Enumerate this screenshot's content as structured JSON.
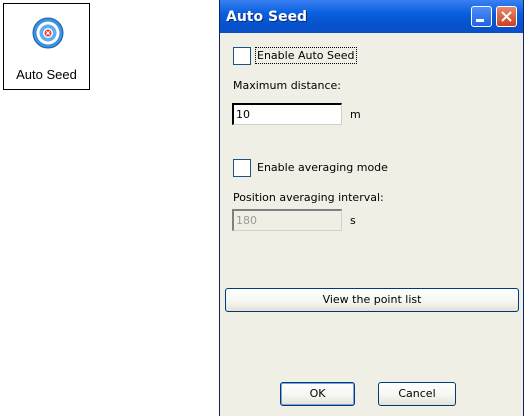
{
  "desktop_icon": {
    "label": "Auto Seed",
    "icon": "target-icon",
    "colors": {
      "outer": "#4aa3f0",
      "inner": "#e03030"
    }
  },
  "dialog": {
    "title": "Auto Seed",
    "enable_auto_seed": {
      "label": "Enable Auto Seed",
      "checked": false
    },
    "max_distance": {
      "label": "Maximum distance:",
      "value": "10",
      "unit": "m"
    },
    "enable_averaging": {
      "label": "Enable averaging mode",
      "checked": false
    },
    "averaging_interval": {
      "label": "Position averaging interval:",
      "value": "180",
      "unit": "s",
      "disabled": true
    },
    "view_point_list_label": "View the point list",
    "ok_label": "OK",
    "cancel_label": "Cancel"
  },
  "colors": {
    "titlebar": "#0a5fde",
    "dialog_bg": "#f0efe6",
    "close_button": "#c8401f"
  }
}
